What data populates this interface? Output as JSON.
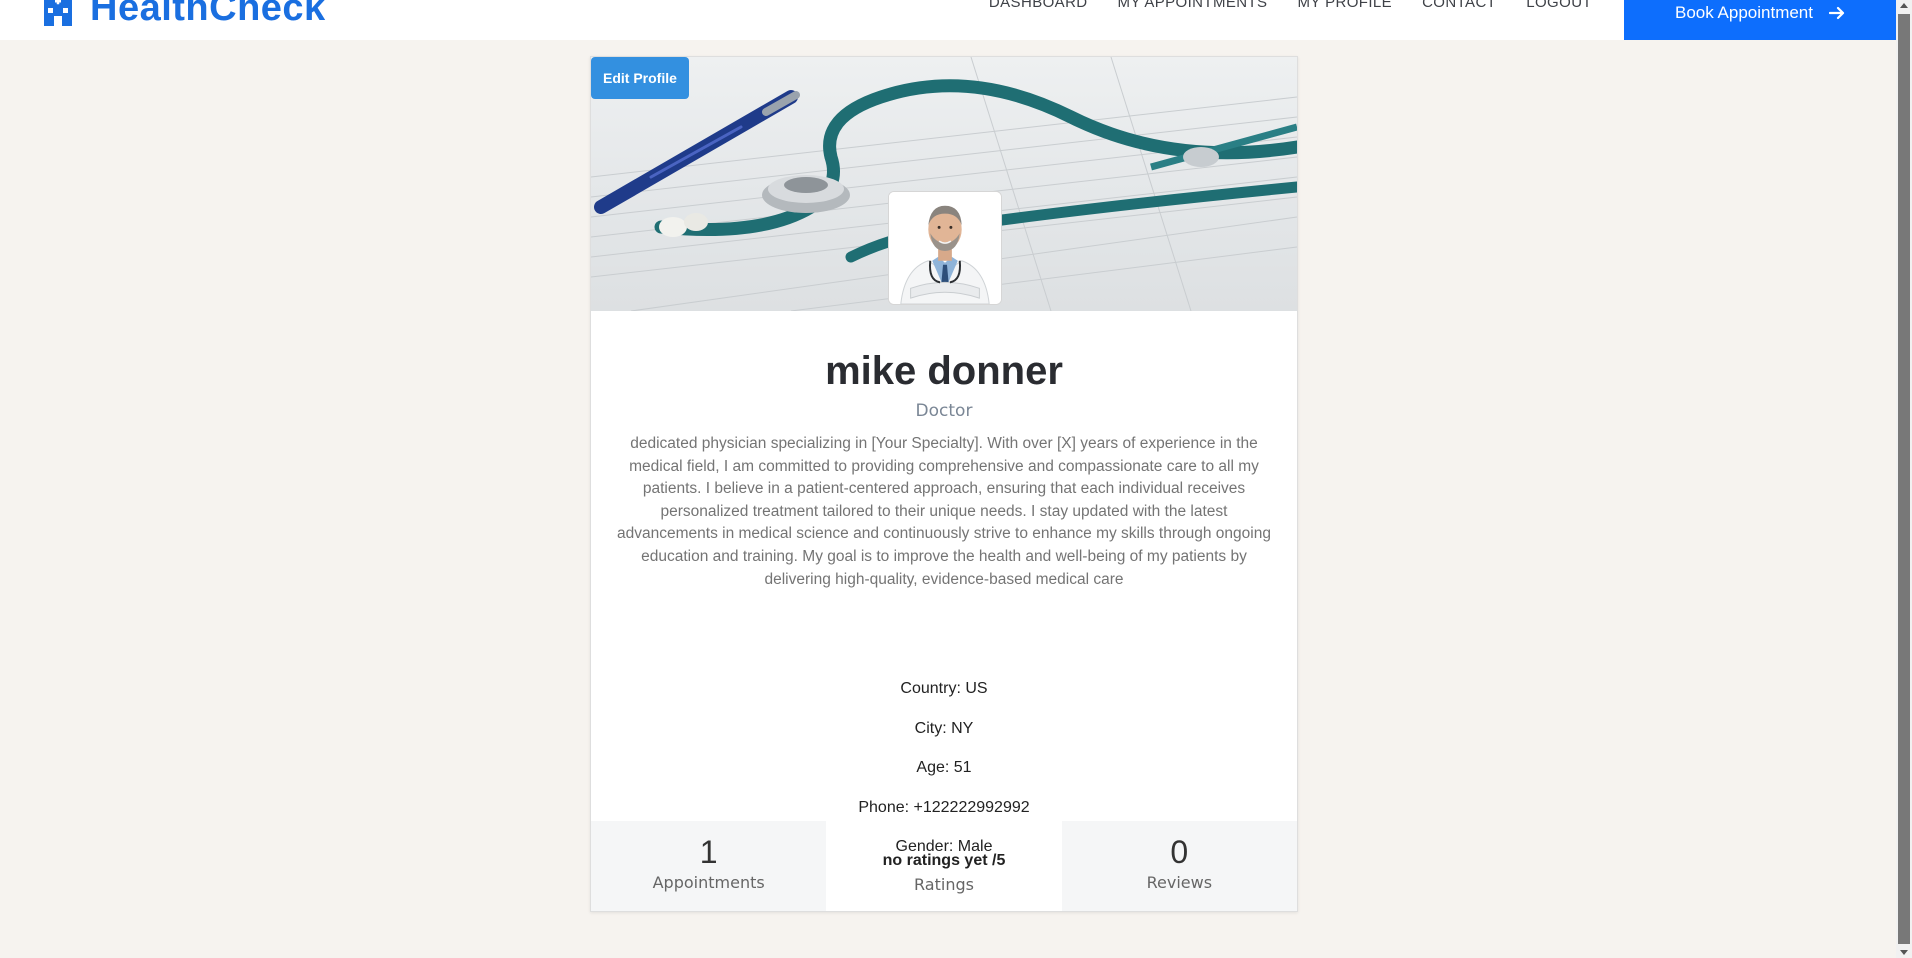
{
  "brand": {
    "name": "HealthCheck",
    "icon": "hospital-icon",
    "color": "#1a6fe0"
  },
  "nav": {
    "links": [
      "DASHBOARD",
      "MY APPOINTMENTS",
      "MY PROFILE",
      "CONTACT",
      "LOGOUT"
    ],
    "book_label": "Book Appointment",
    "book_color": "#0d6efd"
  },
  "profile": {
    "edit_label": "Edit Profile",
    "name": "mike donner",
    "role": "Doctor",
    "bio": "dedicated physician specializing in [Your Specialty]. With over [X] years of experience in the medical field, I am committed to providing comprehensive and compassionate care to all my patients. I believe in a patient-centered approach, ensuring that each individual receives personalized treatment tailored to their unique needs. I stay updated with the latest advancements in medical science and continuously strive to enhance my skills through ongoing education and training. My goal is to improve the health and well-being of my patients by delivering high-quality, evidence-based medical care",
    "details": [
      "Country: US",
      "City: NY",
      "Age: 51",
      "Phone: +122222992992",
      "Gender: Male"
    ]
  },
  "stats": [
    {
      "value": "1",
      "label": "Appointments"
    },
    {
      "value": "no ratings yet /5",
      "label": "Ratings"
    },
    {
      "value": "0",
      "label": "Reviews"
    }
  ]
}
